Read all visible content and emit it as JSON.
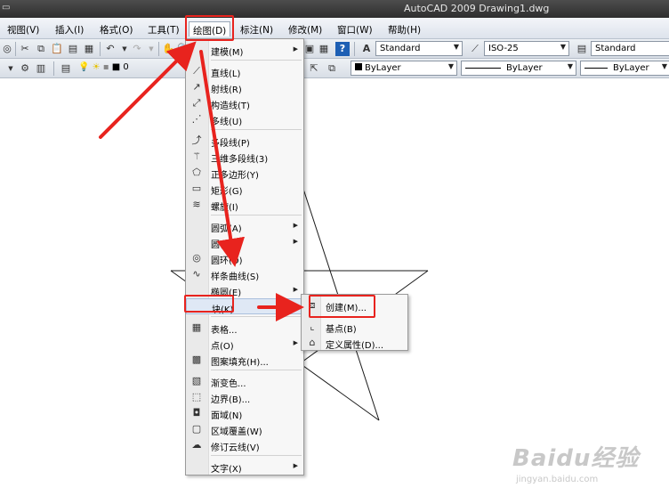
{
  "window": {
    "title": "AutoCAD 2009  Drawing1.dwg"
  },
  "menubar": {
    "items": [
      "视图(V)",
      "插入(I)",
      "格式(O)",
      "工具(T)",
      "绘图(D)",
      "标注(N)",
      "修改(M)",
      "窗口(W)",
      "帮助(H)"
    ],
    "active": "绘图(D)"
  },
  "toolbar": {
    "text_style": "Standard",
    "dim_style": "ISO-25",
    "table_style": "Standard",
    "layer": "0",
    "color": "ByLayer",
    "linetype": "ByLayer",
    "lineweight": "ByLayer"
  },
  "draw_menu": {
    "items": [
      {
        "label": "建模(M)",
        "icon": "none",
        "submenu": true
      },
      {
        "label": "直线(L)",
        "icon": "line-icon"
      },
      {
        "label": "射线(R)",
        "icon": "ray-icon"
      },
      {
        "label": "构造线(T)",
        "icon": "xline-icon"
      },
      {
        "label": "多线(U)",
        "icon": "mline-icon"
      },
      {
        "label": "多段线(P)",
        "icon": "polyline-icon"
      },
      {
        "label": "三维多段线(3)",
        "icon": "3dpoly-icon"
      },
      {
        "label": "正多边形(Y)",
        "icon": "polygon-icon"
      },
      {
        "label": "矩形(G)",
        "icon": "rectangle-icon"
      },
      {
        "label": "螺旋(I)",
        "icon": "helix-icon"
      },
      {
        "label": "圆弧(A)",
        "icon": "none",
        "submenu": true
      },
      {
        "label": "圆(C)",
        "icon": "none",
        "submenu": true
      },
      {
        "label": "圆环(D)",
        "icon": "donut-icon"
      },
      {
        "label": "样条曲线(S)",
        "icon": "spline-icon"
      },
      {
        "label": "椭圆(E)",
        "icon": "none",
        "submenu": true
      },
      {
        "label": "块(K)",
        "icon": "none",
        "submenu": true
      },
      {
        "label": "表格...",
        "icon": "table-icon"
      },
      {
        "label": "点(O)",
        "icon": "none",
        "submenu": true
      },
      {
        "label": "图案填充(H)...",
        "icon": "hatch-icon"
      },
      {
        "label": "渐变色...",
        "icon": "gradient-icon"
      },
      {
        "label": "边界(B)...",
        "icon": "boundary-icon"
      },
      {
        "label": "面域(N)",
        "icon": "region-icon"
      },
      {
        "label": "区域覆盖(W)",
        "icon": "wipeout-icon"
      },
      {
        "label": "修订云线(V)",
        "icon": "revcloud-icon"
      },
      {
        "label": "文字(X)",
        "icon": "none",
        "submenu": true
      }
    ],
    "highlighted": "块(K)"
  },
  "block_menu": {
    "items": [
      {
        "label": "创建(M)...",
        "icon": "block-create-icon"
      },
      {
        "label": "基点(B)",
        "icon": "base-point-icon"
      },
      {
        "label": "定义属性(D)...",
        "icon": "define-attribute-icon"
      }
    ]
  },
  "annotation_color": "#e8231e",
  "watermark": {
    "logo": "Baidu经验",
    "url": "jingyan.baidu.com"
  }
}
